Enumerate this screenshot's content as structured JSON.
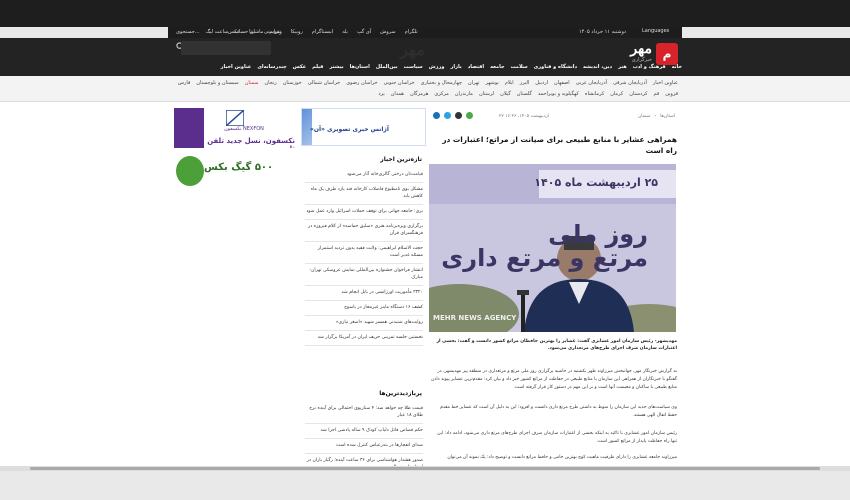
{
  "utility": {
    "date": "دوشنبه ۱۱ خرداد ۱۴۰۵",
    "languages": "Languages",
    "social": [
      "تلگرام",
      "سروش",
      "آی گپ",
      "بله",
      "اینستاگرام",
      "روبیکا",
      "ویراستی",
      "ایتا",
      "عکس"
    ],
    "tools": [
      "جستجوی...",
      "ساعت لیگ",
      "ماشین حساب",
      "تقویم"
    ]
  },
  "header": {
    "logo_text": "مهر",
    "logo_sub": "خبرگزاری",
    "logo_mark": "م",
    "watermark": "مهر",
    "search_placeholder": ""
  },
  "main_nav": [
    "خانه",
    "فرهنگ و ادب",
    "هنر",
    "دین، اندیشه",
    "دانشگاه و فناوری",
    "سلامت",
    "جامعه",
    "اقتصاد",
    "بازار",
    "ورزش",
    "سیاست",
    "بین‌الملل",
    "استان‌ها",
    "بیشتر",
    "فیلم",
    "عکس",
    "چندرسانه‌ای",
    "عناوین اخبار"
  ],
  "provinces_row1": [
    "عناوین اخبار",
    "آذربایجان شرقی",
    "آذربایجان غربی",
    "اصفهان",
    "اردبیل",
    "البرز",
    "ایلام",
    "بوشهر",
    "تهران",
    "چهارمحال و بختیاری",
    "خراسان جنوبی",
    "خراسان رضوی",
    "خراسان شمالی",
    "خوزستان",
    "زنجان",
    "سمنان",
    "سیستان و بلوچستان",
    "فارس"
  ],
  "provinces_row2": [
    "قزوین",
    "قم",
    "کردستان",
    "کرمان",
    "کرمانشاه",
    "کهگیلویه و بویراحمد",
    "گلستان",
    "گیلان",
    "لرستان",
    "مازندران",
    "مرکزی",
    "هرمزگان",
    "همدان",
    "یزد"
  ],
  "provinces_active": "سمنان",
  "article": {
    "breadcrumb": [
      "استان‌ها",
      "سمنان"
    ],
    "pubdate": "۲۷ اردیبهشت ۱۴۰۵، ۱۶:۲۶",
    "headline": "همراهی عشایر با منابع طبیعی برای صیانت از مراتع؛ اعتبارات در راه است",
    "photo_banner_date": "۲۵ اردیبهشت ماه ۱۴۰۵",
    "photo_banner_line1": "روز ملی",
    "photo_banner_line2": "مرتع و مرتع داری",
    "photo_agency": "MEHR NEWS AGENCY",
    "caption": "مهدیشهر- رئیس سازمان امور عشایری گفت: عشایر را بهترین حافظان مراتع کشور دانست و گفت: بخشی از اعتبارات سازمان صرف اجرای طرح‌های مرتعداری می‌شود.",
    "paragraphs": [
      "به گزارش خبرنگار مهر، جهانبخش میرزاوند ظهر یکشنبه در حاشیه برگزاری روز ملی مرتع و مرتعداری در منطقه پیر مهدیشهر، در گفتگو با خبرنگاران از همراهی این سازمان با منابع طبیعی در حفاظت از مراتع کشور خبر داد و بیان کرد: مقدم‌ترین عشایر پیوند دادن منابع طبیعی با ساکنان و معیشت آنها است و بر این مهم در دستور کار قرار گرفته است.",
      "وی سیاست‌های جدید این سازمان را منوط به داشتن طرح مرتع داری دانست و افزود: این به دلیل آن است که عشایر خط مقدم حفظ انفال الهی هستند.",
      "رئیس سازمان امور عشایری با تاکید به اینکه بخشی از اعتبارات سازمان صرف اجرای طرح‌های مرتع داری می‌شود، ادامه داد: این تنها راه حفاظت پایدار از مراتع کشور است.",
      "میرزاوند جامعه عشایری را دارای ظرفیت ماهیت کوچ بهترین حامی و حافظ مراتع دانست و توضیح داد: یک نمونه آن می‌توان"
    ]
  },
  "news": {
    "agency_ad": "آژانس خبری تصویری «آن»",
    "latest_title": "تازه‌ترین اخبار",
    "latest": [
      "قیامت‌تان درختی گالری‌خانه آثار می‌شود",
      "مشکل بوی نامطبوع فاضلاب کارخانه قند یازد طرف یک ماه کاهش یابد",
      "بری: جامعه جهانی برای توقف حملات اسرائیل وارد عمل شود",
      "برگزاری ویژه‌برنامه هنری «سلیق حماسه» از کلام فیروزه در فرهنگسرای قرآن",
      "حجت الاسلام ابراهیمی: ولایت فقیه بدون تردید استمرار مسئله غدیر است",
      "انتشار فراخوان جشنواره بین‌المللی نمایش عروسکی تهران-مبارک",
      "۳۳۲۰ مأموریت اورژانسی در بابل انجام شد",
      "کشف ۱۶ دستگاه ماینر غیرمجاز در یاسوج",
      "روایت‌های شنیدنی همسر شهید «اصغر نیازی»",
      "نخستین جلسه تمرینی حریف ایران در آمریکا برگزار شد"
    ],
    "popular_title": "پربازدیدترین‌ها",
    "popular": [
      "قیمت طلا چه خواهد شد: ۴ سناریوی احتمالی برای آینده نرخ طلای ۱۸ عیار",
      "حکم قصاص قاتل دلیاپ کودک ۹ ساله پادشی اجرا شد",
      "صدای انفجارها در بندرعباس کنترل شده است",
      "صدور هشدار هواشناسی برای ۳۶ ساعت آینده؛ رگبار باران در استان‌های شمالی",
      "انصاری: انسان ماحصل دعوت رسمی از مسئولان برای مراسم ۱۴ خرداد نداریم"
    ]
  },
  "ads": {
    "nexfon_brand": "NEXFON",
    "nexfon_brand_fa": "نکسفون",
    "nexfon_slogan": "نکسفون، نسل جدید تلفن ثابت",
    "gig_text": "۵۰۰ گیگ بکس"
  },
  "colors": {
    "brand_red": "#d6242a",
    "header_bg": "#232323",
    "nexfon_purple": "#5b2e8e"
  }
}
